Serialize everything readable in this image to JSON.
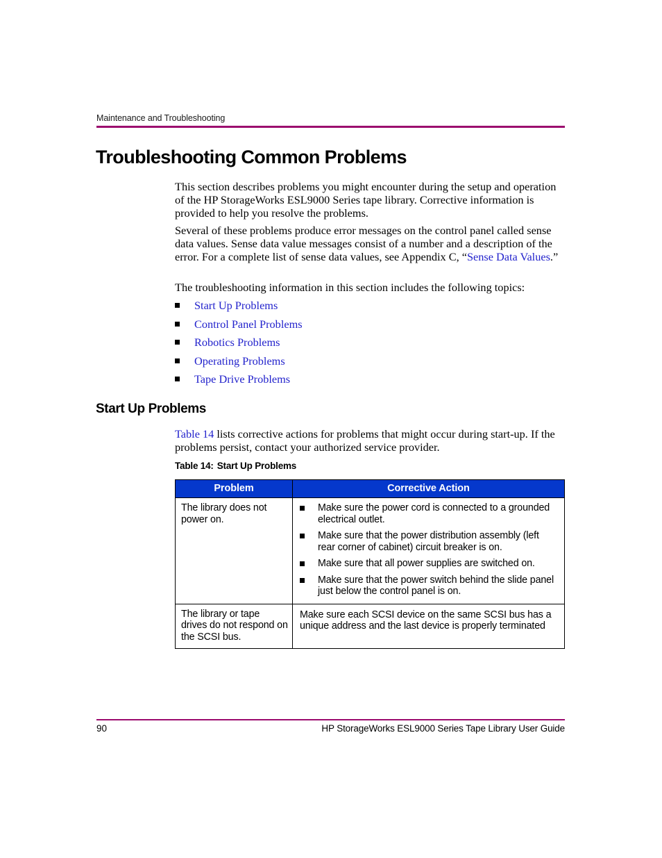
{
  "running_header": {
    "text": "Maintenance and Troubleshooting"
  },
  "headings": {
    "h1": "Troubleshooting Common Problems",
    "h2": "Start Up Problems"
  },
  "paragraphs": {
    "p1": "This section describes problems you might encounter during the setup and operation of the HP StorageWorks ESL9000 Series tape library. Corrective information is provided to help you resolve the problems.",
    "p2_before_link": "Several of these problems produce error messages on the control panel called sense data values. Sense data value messages consist of a number and a description of the error. For a complete list of sense data values, see Appendix C, “",
    "p2_link": "Sense Data Values",
    "p2_after_link": ".”",
    "p3": "The troubleshooting information in this section includes the following topics:",
    "p4_link": "Table 14",
    "p4_rest": " lists corrective actions for problems that might occur during start-up. If the problems persist, contact your authorized service provider."
  },
  "topics": [
    {
      "label": "Start Up Problems"
    },
    {
      "label": "Control Panel Problems"
    },
    {
      "label": "Robotics Problems"
    },
    {
      "label": "Operating Problems"
    },
    {
      "label": "Tape Drive Problems"
    }
  ],
  "table": {
    "caption_number": "Table 14:",
    "caption_title": "Start Up Problems",
    "columns": [
      "Problem",
      "Corrective Action"
    ],
    "rows": [
      {
        "problem": "The library does not power on.",
        "actions": [
          "Make sure the power cord is connected to a grounded electrical outlet.",
          "Make sure that the power distribution assembly (left rear corner of cabinet) circuit breaker is on.",
          "Make sure that all power supplies are switched on.",
          "Make sure that the power switch behind the slide panel just below the control panel is on."
        ],
        "action_plain": null
      },
      {
        "problem": "The library or tape drives do not respond on the SCSI bus.",
        "actions": null,
        "action_plain": "Make sure each SCSI device on the same SCSI bus has a unique address and the last device is properly terminated"
      }
    ]
  },
  "footer": {
    "page_number": "90",
    "document_title": "HP StorageWorks ESL9000 Series Tape Library User Guide"
  },
  "colors": {
    "rule": "#9B0B6E",
    "table_header_bg": "#0538CC",
    "link": "#2222cc"
  }
}
